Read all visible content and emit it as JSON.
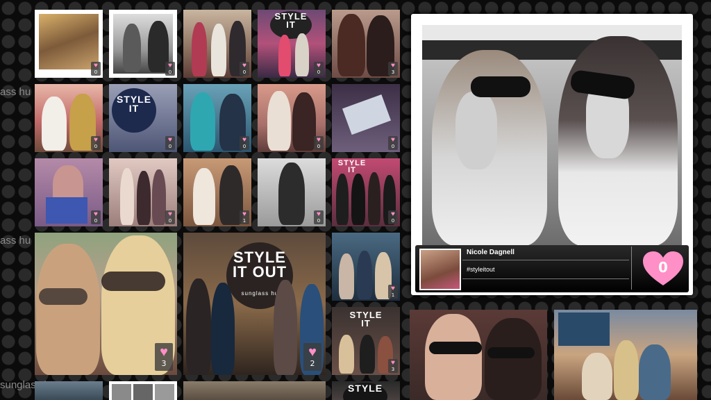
{
  "background_text": [
    "ass hu",
    "ass hu",
    "sunglass hut"
  ],
  "tile_texts": {
    "style": "STYLE",
    "it": "IT",
    "it_out": "IT OUT",
    "sunglass": "sunglass hut"
  },
  "feature": {
    "user_name": "Nicole Dagnell",
    "caption": "#styleitout",
    "like_count": "0"
  },
  "tiles": [
    {
      "likes": "0"
    },
    {
      "likes": "0"
    },
    {
      "likes": "0"
    },
    {
      "likes": "0"
    },
    {
      "likes": "3"
    },
    {
      "likes": "0"
    },
    {
      "likes": "0"
    },
    {
      "likes": "0"
    },
    {
      "likes": "0"
    },
    {
      "likes": "0"
    },
    {
      "likes": "0"
    },
    {
      "likes": "0"
    },
    {
      "likes": "1"
    },
    {
      "likes": "0"
    },
    {
      "likes": "0"
    },
    {
      "likes": "3"
    },
    {
      "likes": "2"
    },
    {
      "likes": "1"
    },
    {
      "likes": "3"
    }
  ],
  "colors": {
    "heart": "#ff8fc7",
    "panel_bg": "#ffffff",
    "info_bar": "#000000"
  }
}
